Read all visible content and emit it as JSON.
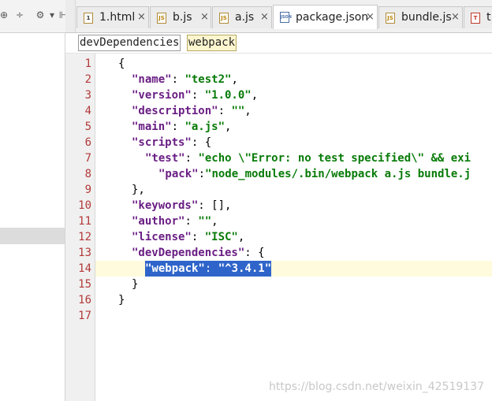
{
  "toolbar": {
    "icons": [
      "target-icon",
      "collapse-icon",
      "gear-icon",
      "hide-icon"
    ]
  },
  "tabs": [
    {
      "label": "1.html",
      "icon": "html-file-icon",
      "badge": "1",
      "active": false
    },
    {
      "label": "b.js",
      "icon": "js-file-icon",
      "badge": "JS",
      "active": false
    },
    {
      "label": "a.js",
      "icon": "js-file-icon",
      "badge": "JS",
      "active": false
    },
    {
      "label": "package.json",
      "icon": "json-file-icon",
      "badge": "JSON",
      "active": true
    },
    {
      "label": "bundle.js",
      "icon": "js-file-icon",
      "badge": "JS",
      "active": false
    },
    {
      "label": "t",
      "icon": "text-file-icon",
      "badge": "T",
      "active": false
    }
  ],
  "close_glyph": "×",
  "breadcrumb": [
    "devDependencies",
    "webpack"
  ],
  "line_numbers": [
    "1",
    "2",
    "3",
    "4",
    "5",
    "6",
    "7",
    "8",
    "9",
    "10",
    "11",
    "12",
    "13",
    "14",
    "15",
    "16",
    "17"
  ],
  "code": {
    "l1": "{",
    "name_key": "\"name\"",
    "name_val": "\"test2\"",
    "version_key": "\"version\"",
    "version_val": "\"1.0.0\"",
    "description_key": "\"description\"",
    "description_val": "\"\"",
    "main_key": "\"main\"",
    "main_val": "\"a.js\"",
    "scripts_key": "\"scripts\"",
    "test_key": "\"test\"",
    "test_val": "\"echo \\\"Error: no test specified\\\" && exi",
    "pack_key": "\"pack\"",
    "pack_val": "\"node_modules/.bin/webpack a.js bundle.j",
    "scripts_close": "},",
    "keywords_key": "\"keywords\"",
    "keywords_val": "[],",
    "author_key": "\"author\"",
    "author_val": "\"\"",
    "license_key": "\"license\"",
    "license_val": "\"ISC\"",
    "devdeps_key": "\"devDependencies\"",
    "webpack_key": "\"webpack\"",
    "webpack_val": "\"^3.4.1\"",
    "devdeps_close": "}",
    "root_close": "}"
  },
  "watermark": "https://blog.csdn.net/weixin_42519137",
  "colors": {
    "key": "#6a1e84",
    "string": "#087b08",
    "line_number": "#b33a3a",
    "selection": "#2f65ca",
    "caret_line": "#fffbdc"
  }
}
